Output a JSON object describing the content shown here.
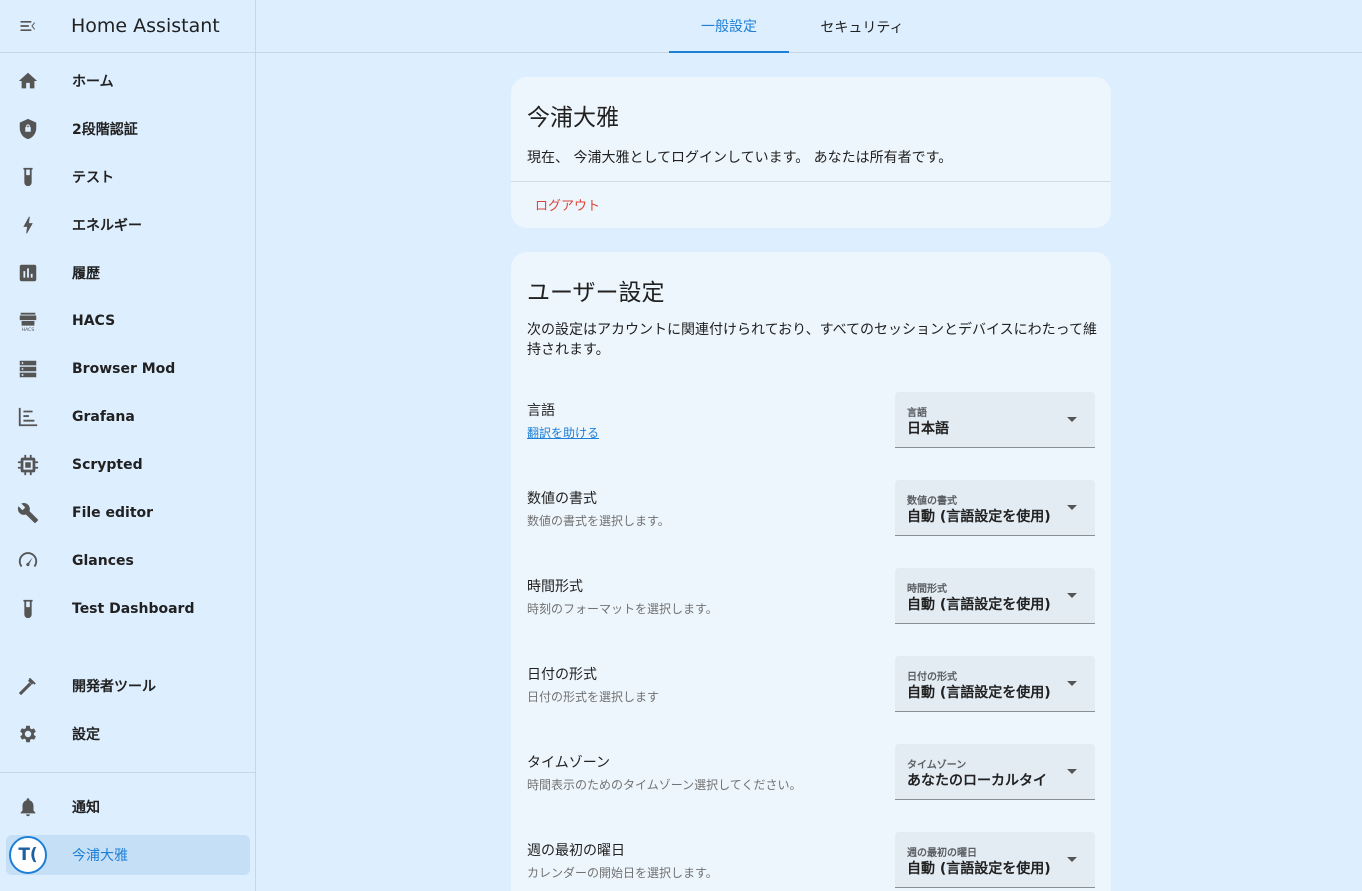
{
  "app_title": "Home Assistant",
  "sidebar": {
    "items": [
      {
        "label": "ホーム",
        "icon": "home-icon"
      },
      {
        "label": "2段階認証",
        "icon": "shield-icon"
      },
      {
        "label": "テスト",
        "icon": "test-tube-icon"
      },
      {
        "label": "エネルギー",
        "icon": "lightning-icon"
      },
      {
        "label": "履歴",
        "icon": "chart-box-icon"
      },
      {
        "label": "HACS",
        "icon": "hacs-icon"
      },
      {
        "label": "Browser Mod",
        "icon": "server-icon"
      },
      {
        "label": "Grafana",
        "icon": "chart-timeline-icon"
      },
      {
        "label": "Scrypted",
        "icon": "chip-icon"
      },
      {
        "label": "File editor",
        "icon": "wrench-icon"
      },
      {
        "label": "Glances",
        "icon": "gauge-icon"
      },
      {
        "label": "Test Dashboard",
        "icon": "test-tube-icon"
      },
      {
        "label": "開発者ツール",
        "icon": "hammer-icon"
      },
      {
        "label": "設定",
        "icon": "gear-icon"
      }
    ],
    "notifications_label": "通知",
    "user": {
      "name": "今浦大雅",
      "initials": "T("
    }
  },
  "tabs": [
    {
      "label": "一般設定",
      "active": true
    },
    {
      "label": "セキュリティ",
      "active": false
    }
  ],
  "profile": {
    "name": "今浦大雅",
    "message": "現在、 今浦大雅としてログインしています。 あなたは所有者です。",
    "logout_label": "ログアウト"
  },
  "user_settings": {
    "title": "ユーザー設定",
    "description": "次の設定はアカウントに関連付けられており、すべてのセッションとデバイスにわたって維持されます。",
    "rows": [
      {
        "name": "言語",
        "sub": "翻訳を助ける",
        "select_label": "言語",
        "select_value": "日本語"
      },
      {
        "name": "数値の書式",
        "sub": "数値の書式を選択します。",
        "select_label": "数値の書式",
        "select_value": "自動 (言語設定を使用)"
      },
      {
        "name": "時間形式",
        "sub": "時刻のフォーマットを選択します。",
        "select_label": "時間形式",
        "select_value": "自動 (言語設定を使用)"
      },
      {
        "name": "日付の形式",
        "sub": "日付の形式を選択します",
        "select_label": "日付の形式",
        "select_value": "自動 (言語設定を使用)"
      },
      {
        "name": "タイムゾーン",
        "sub": "時間表示のためのタイムゾーン選択してください。",
        "select_label": "タイムゾーン",
        "select_value": "あなたのローカルタイ"
      },
      {
        "name": "週の最初の曜日",
        "sub": "カレンダーの開始日を選択します。",
        "select_label": "週の最初の曜日",
        "select_value": "自動 (言語設定を使用)"
      }
    ]
  },
  "colors": {
    "accent": "#1e7fd6",
    "danger": "#db4437",
    "background": "#ddeeff"
  }
}
